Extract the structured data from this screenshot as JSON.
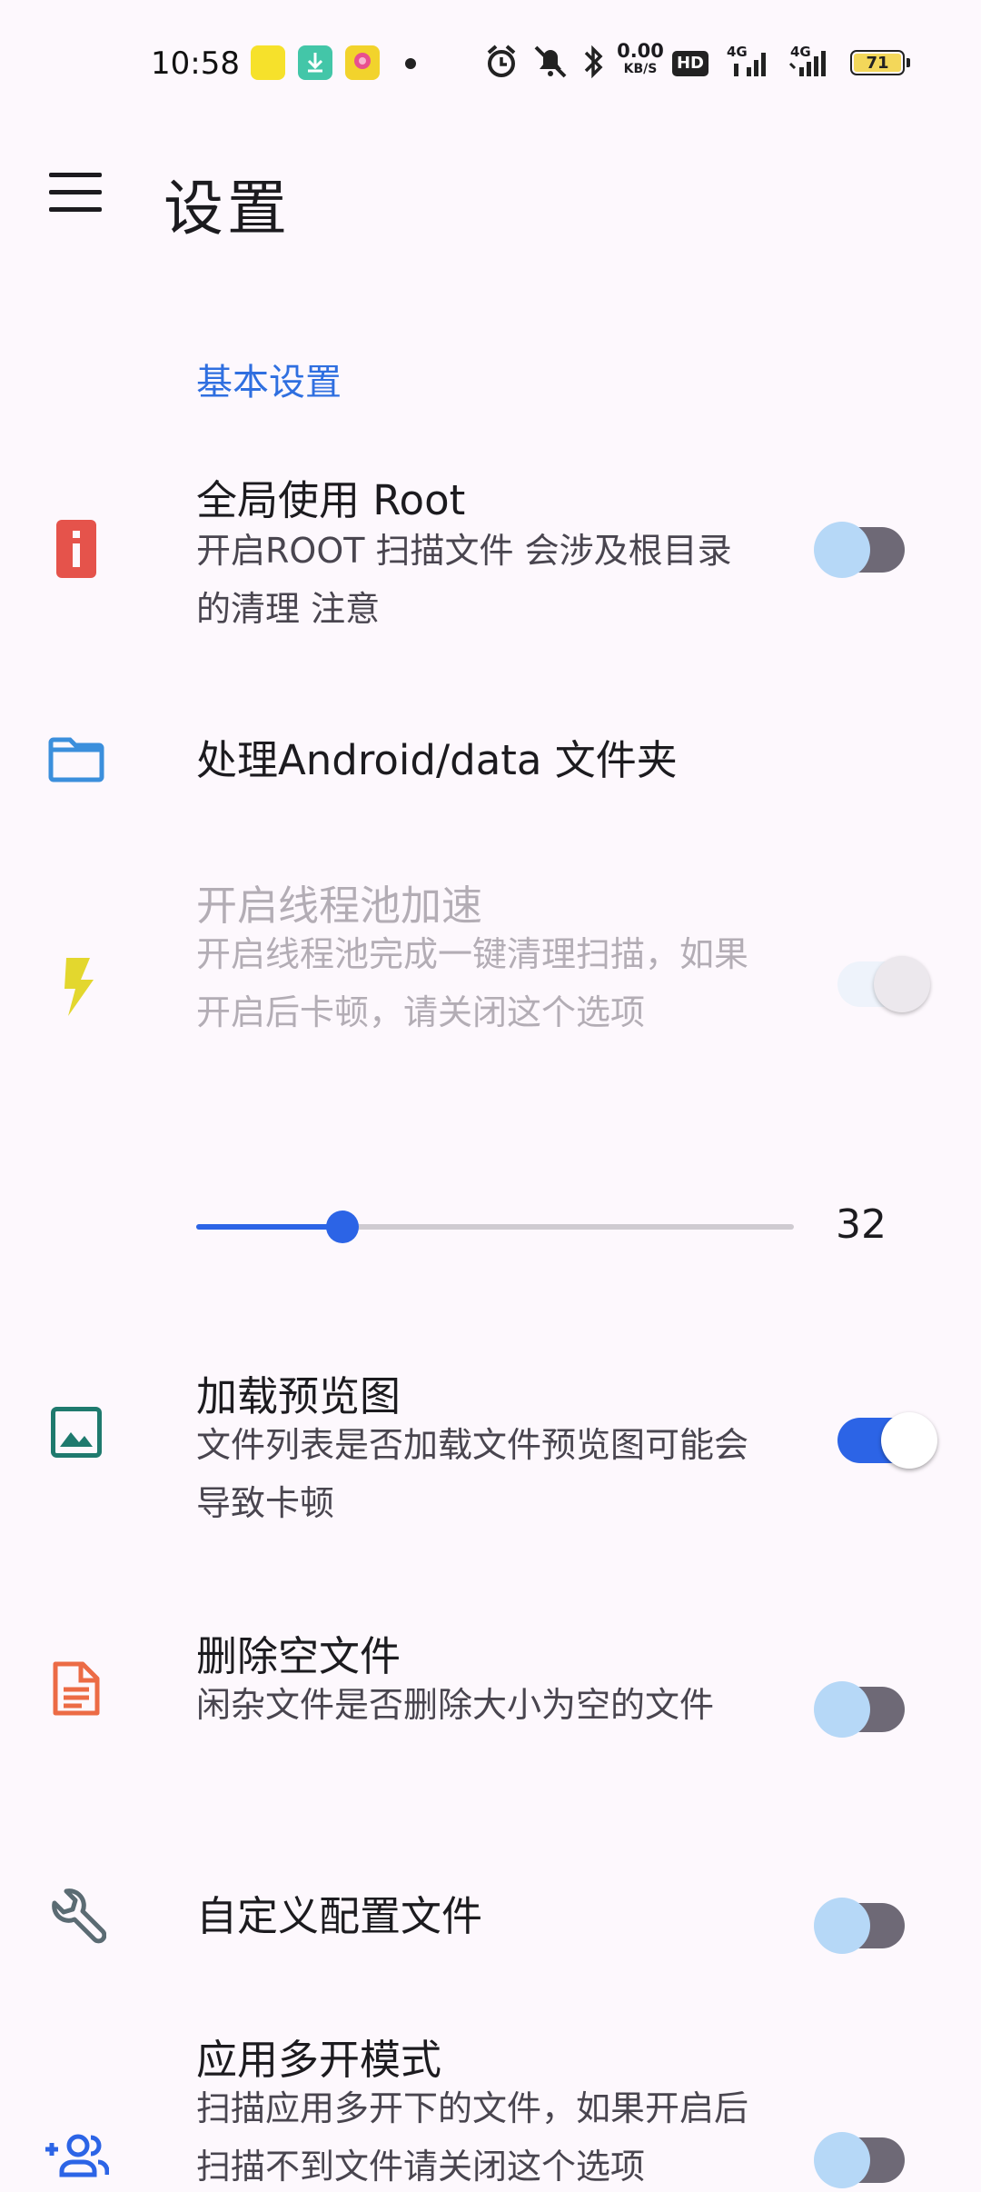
{
  "status_bar": {
    "time": "10:58",
    "net_speed_value": "0.00",
    "net_speed_unit": "KB/S",
    "hd_label": "HD",
    "signal_label_1": "4G",
    "signal_label_2": "4G",
    "battery": "71"
  },
  "app_bar": {
    "title": "设置"
  },
  "section": {
    "title": "基本设置"
  },
  "items": [
    {
      "title": "全局使用 Root",
      "subtitle": "开启ROOT 扫描文件 会涉及根目录的清理 注意",
      "icon": "info-box-icon",
      "switch": "off"
    },
    {
      "title": "处理Android/data 文件夹",
      "subtitle": "",
      "icon": "folder-icon"
    },
    {
      "title": "开启线程池加速",
      "subtitle": "开启线程池完成一键清理扫描，如果开启后卡顿，请关闭这个选项",
      "icon": "flash-icon",
      "switch": "off",
      "enabled": false
    },
    {
      "title": "加载预览图",
      "subtitle": "文件列表是否加载文件预览图可能会导致卡顿",
      "icon": "image-icon",
      "switch": "on"
    },
    {
      "title": "删除空文件",
      "subtitle": "闲杂文件是否删除大小为空的文件",
      "icon": "document-icon",
      "switch": "off"
    },
    {
      "title": "自定义配置文件",
      "subtitle": "",
      "icon": "wrench-icon",
      "switch": "off"
    },
    {
      "title": "应用多开模式",
      "subtitle": "扫描应用多开下的文件，如果开启后扫描不到文件请关闭这个选项",
      "icon": "add-group-icon",
      "switch": "off"
    }
  ],
  "thread_slider": {
    "value": "32",
    "fraction": 0.245
  },
  "colors": {
    "accent": "#2c64e6",
    "section_title": "#2f6fe0",
    "root_icon": "#e5534b",
    "folder_icon": "#3b8fdc",
    "flash_icon": "#e3d72e",
    "image_icon": "#1f7a6e",
    "document_icon": "#ec6b45",
    "wrench_icon": "#5b6b73",
    "group_icon": "#2c64e6"
  }
}
